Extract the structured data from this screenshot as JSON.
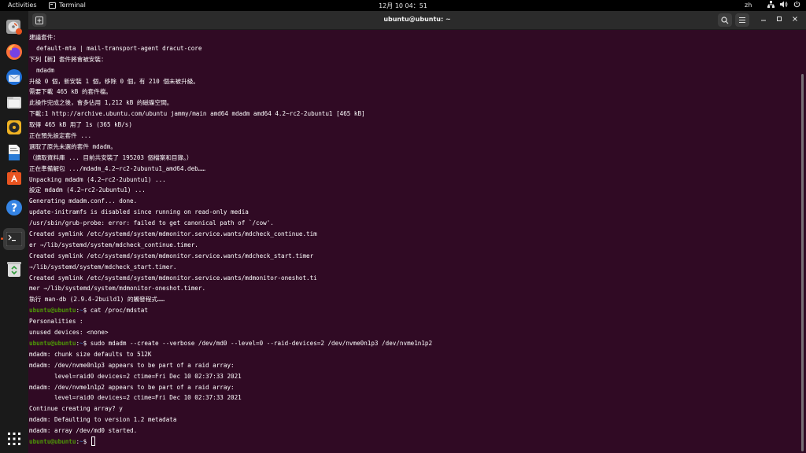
{
  "topbar": {
    "activities": "Activities",
    "app_name": "Terminal",
    "clock": "12月 10 04：51",
    "input_method": "zh"
  },
  "window": {
    "title": "ubuntu@ubuntu: ~"
  },
  "dock": {
    "items": [
      "disk-installer-icon",
      "firefox-icon",
      "thunderbird-icon",
      "files-icon",
      "rhythmbox-icon",
      "writer-icon",
      "software-icon",
      "help-icon",
      "terminal-icon",
      "trash-icon",
      "app-grid-icon"
    ],
    "accent": "#e95420"
  },
  "colors": {
    "terminal_bg": "#300a24",
    "prompt_user": "#4e9a06",
    "prompt_path": "#3465a4"
  },
  "terminal": {
    "lines": [
      "建議套件：",
      "  default-mta | mail-transport-agent dracut-core",
      "下列【新】套件將會被安裝：",
      "  mdadm",
      "升級 0 個，新安裝 1 個，移除 0 個，有 210 個未被升級。",
      "需要下載 465 kB 的套件檔。",
      "此操作完成之後，會多佔用 1,212 kB 的磁碟空間。",
      "下載:1 http://archive.ubuntu.com/ubuntu jammy/main amd64 mdadm amd64 4.2~rc2-2ubuntu1 [465 kB]",
      "取得 465 kB 用了 1s (365 kB/s)",
      "正在預先設定套件 ...",
      "選取了原先未選的套件 mdadm。",
      "（讀取資料庫 ... 目前共安裝了 195203 個檔案和目錄。）",
      "正在準備解包 .../mdadm_4.2~rc2-2ubuntu1_amd64.deb……",
      "Unpacking mdadm (4.2~rc2-2ubuntu1) ...",
      "設定 mdadm (4.2~rc2-2ubuntu1) ...",
      "Generating mdadm.conf... done.",
      "update-initramfs is disabled since running on read-only media",
      "/usr/sbin/grub-probe: error: failed to get canonical path of `/cow'.",
      "Created symlink /etc/systemd/system/mdmonitor.service.wants/mdcheck_continue.tim",
      "er →/lib/systemd/system/mdcheck_continue.timer.",
      "Created symlink /etc/systemd/system/mdmonitor.service.wants/mdcheck_start.timer",
      "→/lib/systemd/system/mdcheck_start.timer.",
      "Created symlink /etc/systemd/system/mdmonitor.service.wants/mdmonitor-oneshot.ti",
      "mer →/lib/systemd/system/mdmonitor-oneshot.timer.",
      "執行 man-db (2.9.4-2build1) 的觸發程式……"
    ],
    "prompt_user": "ubuntu@ubuntu",
    "prompt_sep": ":",
    "prompt_path": "~",
    "prompt_symbol": "$ ",
    "cmd1": "cat /proc/mdstat",
    "out1": [
      "Personalities :",
      "unused devices: <none>"
    ],
    "cmd2": "sudo mdadm --create --verbose /dev/md0 --level=0 --raid-devices=2 /dev/nvme0n1p3 /dev/nvme1n1p2",
    "out2": [
      "mdadm: chunk size defaults to 512K",
      "mdadm: /dev/nvme0n1p3 appears to be part of a raid array:",
      "       level=raid0 devices=2 ctime=Fri Dec 10 02:37:33 2021",
      "mdadm: /dev/nvme1n1p2 appears to be part of a raid array:",
      "       level=raid0 devices=2 ctime=Fri Dec 10 02:37:33 2021",
      "Continue creating array? y",
      "mdadm: Defaulting to version 1.2 metadata",
      "mdadm: array /dev/md0 started."
    ]
  }
}
